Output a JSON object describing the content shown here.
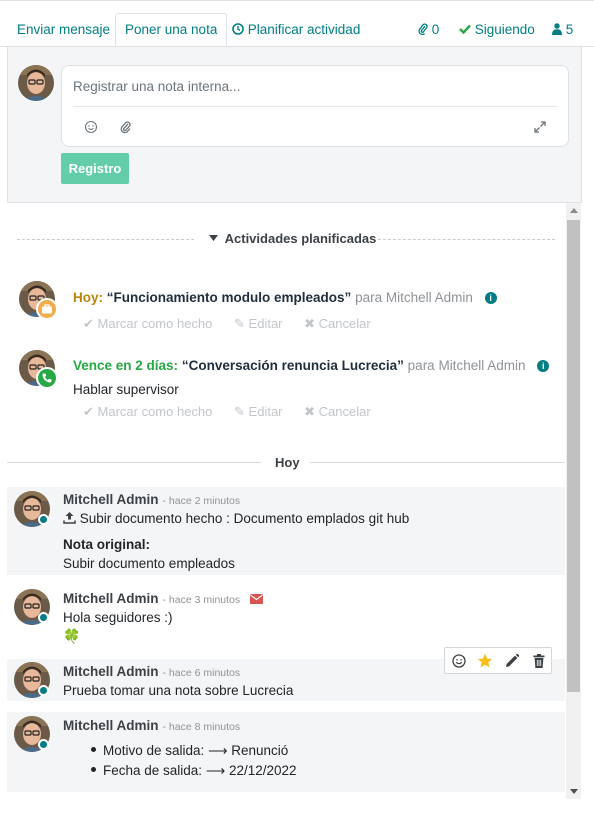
{
  "tabs": {
    "send_message": "Enviar mensaje",
    "log_note": "Poner una nota",
    "schedule_activity": "Planificar actividad",
    "attachments_count": "0",
    "following": "Siguiendo",
    "followers_count": "5"
  },
  "composer": {
    "placeholder": "Registrar una nota interna...",
    "submit_label": "Registro"
  },
  "activities": {
    "header": "Actividades planificadas",
    "items": [
      {
        "when": "Hoy:",
        "summary": "“Funcionamiento modulo empleados”",
        "for": "para Mitchell Admin",
        "note": "",
        "status_color": "#f0ad4e",
        "when_color": "#b8860b",
        "badge_icon": "suitcase-icon"
      },
      {
        "when": "Vence en 2 días:",
        "summary": "“Conversación renuncia Lucrecia”",
        "for": "para Mitchell Admin",
        "note": "Hablar supervisor",
        "status_color": "#28a745",
        "when_color": "#28a745",
        "badge_icon": "phone-icon"
      }
    ],
    "actions": {
      "mark_done": "Marcar como hecho",
      "edit": "Editar",
      "cancel": "Cancelar"
    }
  },
  "messages": {
    "day_separator": "Hoy",
    "items": [
      {
        "author": "Mitchell Admin",
        "ago": "- hace 2 minutos",
        "line1": "Subir documento hecho : Documento emplados git hub",
        "original_label": "Nota original:",
        "original_text": "Subir documento empleados"
      },
      {
        "author": "Mitchell Admin",
        "ago": "- hace 3 minutos",
        "line1": "Hola seguidores :)",
        "emoji": "🍀"
      },
      {
        "author": "Mitchell Admin",
        "ago": "- hace 6 minutos",
        "line1": "Prueba tomar una nota sobre Lucrecia"
      },
      {
        "author": "Mitchell Admin",
        "ago": "- hace 8 minutos",
        "tracking": [
          {
            "field": "Motivo de salida:",
            "value": "Renunció"
          },
          {
            "field": "Fecha de salida:",
            "value": "22/12/2022"
          }
        ]
      }
    ]
  },
  "colors": {
    "brand": "#017e84",
    "primary_button": "#63cda9",
    "star": "#f3c01c",
    "envelope": "#d9534f"
  }
}
